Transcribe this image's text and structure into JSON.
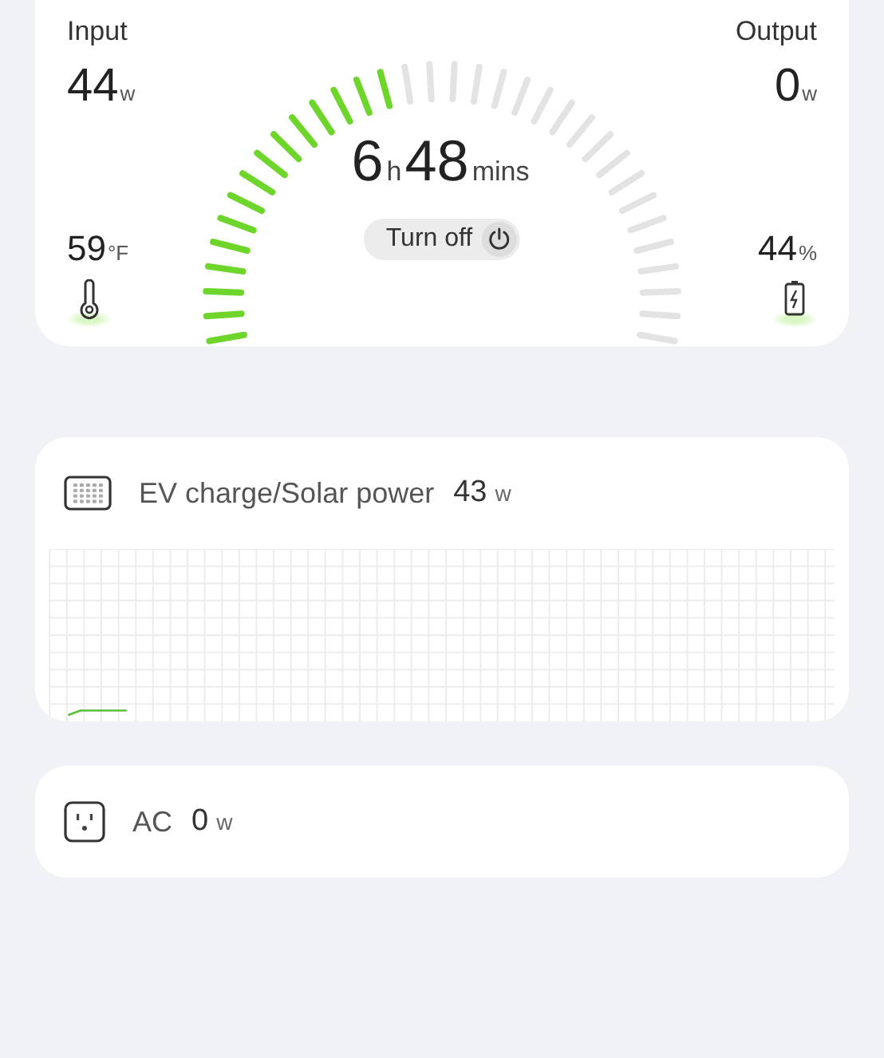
{
  "input": {
    "label": "Input",
    "value": "44",
    "unit": "w"
  },
  "output": {
    "label": "Output",
    "value": "0",
    "unit": "w"
  },
  "temperature": {
    "value": "59",
    "unit": "°F"
  },
  "battery": {
    "value": "44",
    "unit": "%"
  },
  "gauge": {
    "level": 0.44
  },
  "runtime": {
    "hours": "6",
    "hours_unit": "h",
    "minutes": "48",
    "minutes_unit": "mins"
  },
  "power_button": {
    "label": "Turn off"
  },
  "channels": [
    {
      "kind": "solar",
      "label": "EV charge/Solar power",
      "value": "43",
      "unit": "w"
    },
    {
      "kind": "ac",
      "label": "AC",
      "value": "0",
      "unit": "w"
    }
  ]
}
